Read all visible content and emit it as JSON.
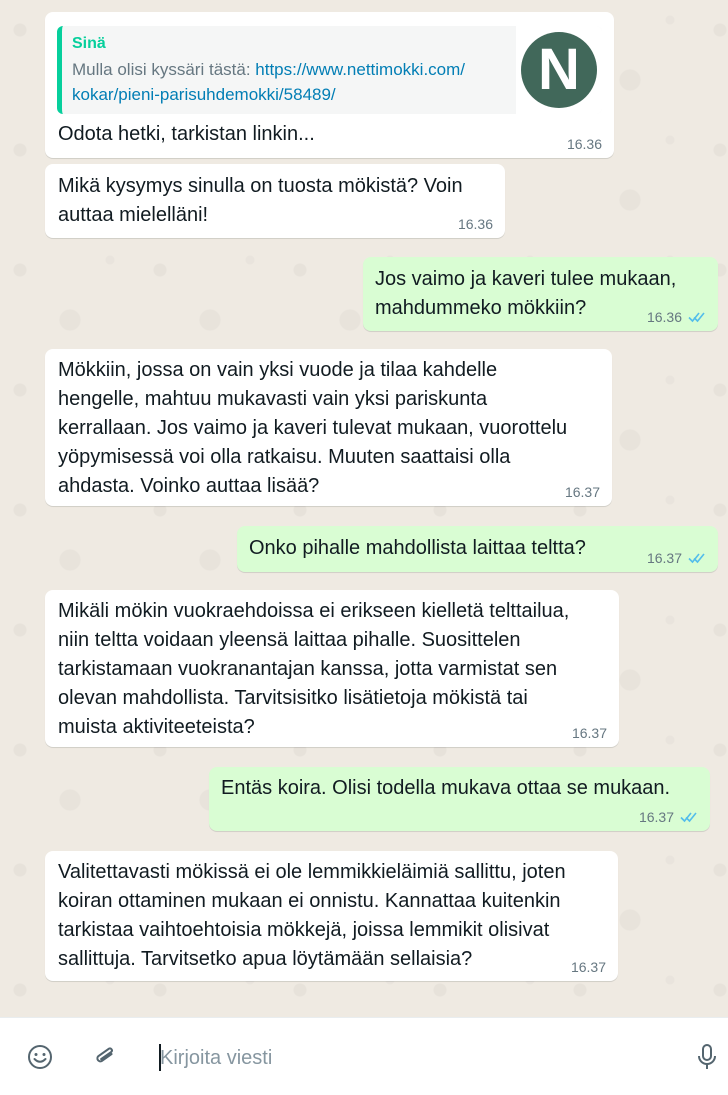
{
  "messages": [
    {
      "direction": "in",
      "quote": {
        "author": "Sinä",
        "text_prefix": "Mulla olisi kyssäri tästä: ",
        "link": "https://www.nettimokki.com/\nkokar/pieni-parisuhdemokki/58489/",
        "thumb_letter": "N"
      },
      "text": "Odota hetki, tarkistan linkin...",
      "time": "16.36"
    },
    {
      "direction": "in",
      "text": "Mikä kysymys sinulla on tuosta mökistä? Voin\nauttaa mielelläni!",
      "time": "16.36"
    },
    {
      "direction": "out",
      "text": "Jos vaimo ja kaveri tulee mukaan,\nmahdummeko mökkiin?",
      "time": "16.36",
      "status": "read"
    },
    {
      "direction": "in",
      "text": "Mökkiin, jossa on vain yksi vuode ja tilaa kahdelle\nhengelle, mahtuu mukavasti vain yksi pariskunta\nkerrallaan. Jos vaimo ja kaveri tulevat mukaan, vuorottelu\nyöpymisessä voi olla ratkaisu. Muuten saattaisi olla\nahdasta. Voinko auttaa lisää?",
      "time": "16.37"
    },
    {
      "direction": "out",
      "text": "Onko pihalle mahdollista laittaa teltta?",
      "time": "16.37",
      "status": "read"
    },
    {
      "direction": "in",
      "text": "Mikäli mökin vuokraehdoissa ei erikseen kielletä telttailua,\nniin teltta voidaan yleensä laittaa pihalle. Suosittelen\ntarkistamaan vuokranantajan kanssa, jotta varmistat sen\nolevan mahdollista. Tarvitsisitko lisätietoja mökistä tai\nmuista aktiviteeteista?",
      "time": "16.37"
    },
    {
      "direction": "out",
      "text": "Entäs koira. Olisi todella mukava ottaa se mukaan.",
      "time": "16.37",
      "status": "read"
    },
    {
      "direction": "in",
      "text": "Valitettavasti mökissä ei ole lemmikkieläimiä sallittu, joten\nkoiran ottaminen mukaan ei onnistu. Kannattaa kuitenkin\ntarkistaa vaihtoehtoisia mökkejä, joissa lemmikit olisivat\nsallittuja. Tarvitsetko apua löytämään sellaisia?",
      "time": "16.37"
    }
  ],
  "composer": {
    "placeholder": "Kirjoita viesti",
    "value": "",
    "icons": [
      "emoji-icon",
      "attach-icon",
      "microphone-icon"
    ]
  },
  "colors": {
    "chat_background": "#efeae2",
    "incoming_bubble": "#ffffff",
    "outgoing_bubble": "#d9fdd3",
    "quote_accent": "#06cf9c",
    "link": "#027eb5",
    "read_ticks": "#53bdeb",
    "timestamp": "#667781"
  }
}
